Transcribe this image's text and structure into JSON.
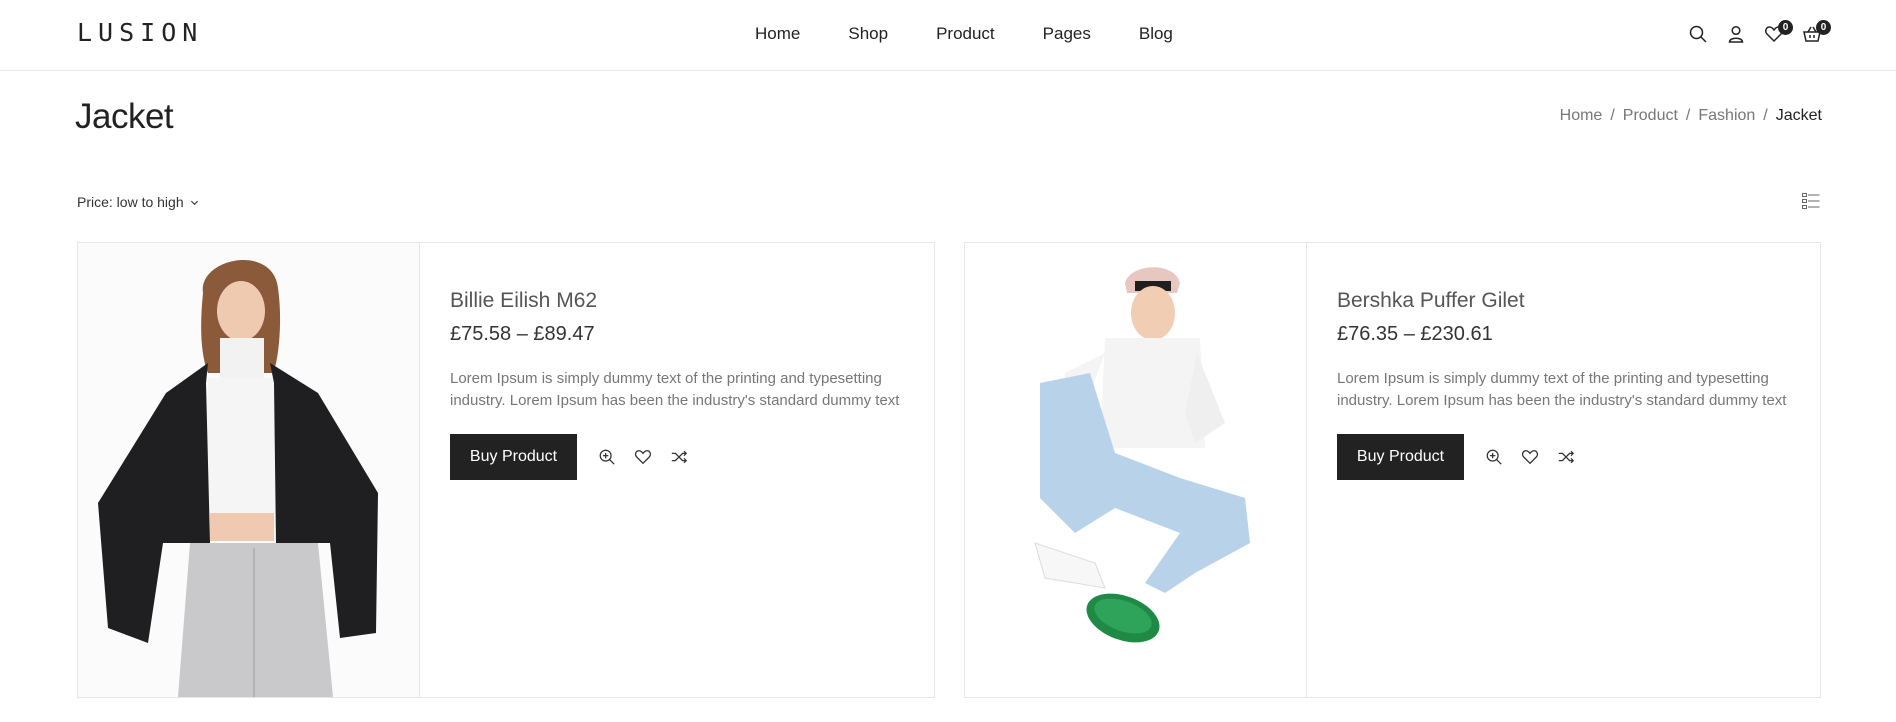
{
  "brand": {
    "logo": "LUSION"
  },
  "nav": [
    "Home",
    "Shop",
    "Product",
    "Pages",
    "Blog"
  ],
  "header_icons": {
    "search": "search-icon",
    "account": "user-icon",
    "wishlist": "heart-icon",
    "wishlist_count": "0",
    "cart": "basket-icon",
    "cart_count": "0"
  },
  "page": {
    "title": "Jacket"
  },
  "breadcrumb": {
    "items": [
      "Home",
      "Product",
      "Fashion"
    ],
    "current": "Jacket",
    "separator": "/"
  },
  "toolbar": {
    "sort_label": "Price: low to high",
    "view_icon": "list-view-icon"
  },
  "products": [
    {
      "name": "Billie Eilish M62",
      "price": "£75.58 – £89.47",
      "description": "Lorem Ipsum is simply dummy text of the printing and typesetting industry. Lorem Ipsum has been the industry's standard dummy text",
      "button": "Buy Product"
    },
    {
      "name": "Bershka Puffer Gilet",
      "price": "£76.35 – £230.61",
      "description": "Lorem Ipsum is simply dummy text of the printing and typesetting industry. Lorem Ipsum has been the industry's standard dummy text",
      "button": "Buy Product"
    }
  ],
  "colors": {
    "primary": "#222222",
    "muted": "#777777",
    "border": "#e6e6e6"
  }
}
